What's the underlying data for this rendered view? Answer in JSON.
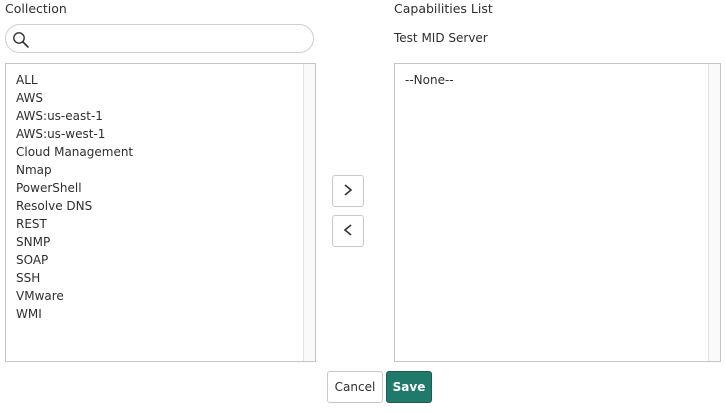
{
  "collection": {
    "label": "Collection",
    "search": {
      "value": "",
      "placeholder": ""
    },
    "items": [
      "ALL",
      "AWS",
      "AWS:us-east-1",
      "AWS:us-west-1",
      "Cloud Management",
      "Nmap",
      "PowerShell",
      "Resolve DNS",
      "REST",
      "SNMP",
      "SOAP",
      "SSH",
      "VMware",
      "WMI"
    ]
  },
  "capabilities": {
    "label": "Capabilities List",
    "server_name": "Test MID Server",
    "items": [
      "--None--"
    ]
  },
  "buttons": {
    "cancel": "Cancel",
    "save": "Save"
  },
  "colors": {
    "accent": "#1f7a6c",
    "border": "#c4c4c4",
    "text": "#2e2e2e"
  },
  "icons": {
    "search": "search-icon",
    "move_right": "chevron-right-icon",
    "move_left": "chevron-left-icon"
  }
}
